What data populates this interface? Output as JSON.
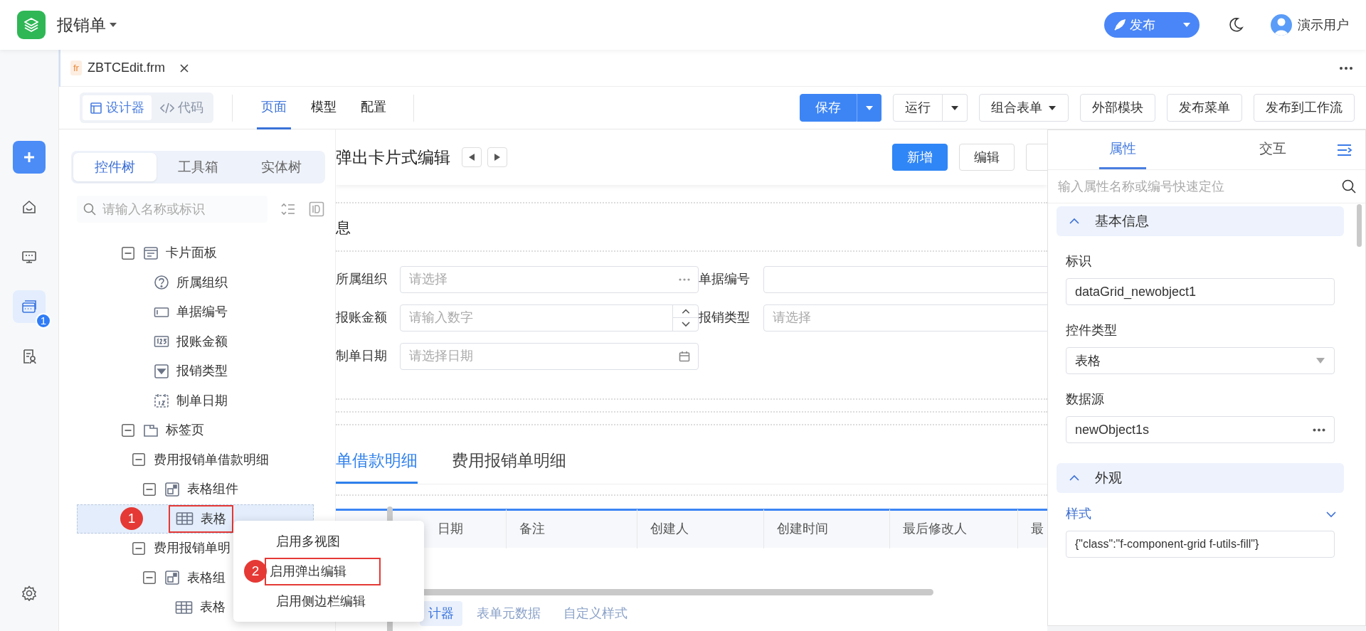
{
  "app": {
    "title": "报销单",
    "publish_button": "发布",
    "user": "演示用户"
  },
  "rail": [
    {
      "kind": "home",
      "selected": false
    },
    {
      "kind": "monitor",
      "selected": false
    },
    {
      "kind": "cards",
      "selected": true,
      "badge": "1"
    },
    {
      "kind": "doc",
      "selected": false
    },
    {
      "kind": "settings",
      "selected": false
    }
  ],
  "file_tab": {
    "prefix": "fr",
    "label": "ZBTCEdit.frm"
  },
  "mode_switch": [
    {
      "label": "设计器",
      "kind": "designer",
      "selected": true
    },
    {
      "label": "代码",
      "kind": "code",
      "selected": false
    }
  ],
  "view_tabs": [
    {
      "label": "页面",
      "selected": true
    },
    {
      "label": "模型",
      "selected": false
    },
    {
      "label": "配置",
      "selected": false
    }
  ],
  "toolbar_buttons": [
    {
      "label": "保存",
      "kind": "primary-split"
    },
    {
      "label": "运行",
      "kind": "split"
    },
    {
      "label": "组合表单",
      "kind": "dropdown"
    },
    {
      "label": "外部模块",
      "kind": "plain"
    },
    {
      "label": "发布菜单",
      "kind": "plain"
    },
    {
      "label": "发布到工作流",
      "kind": "plain"
    }
  ],
  "left_panel": {
    "tabs": [
      {
        "label": "控件树",
        "selected": true
      },
      {
        "label": "工具箱",
        "selected": false
      },
      {
        "label": "实体树",
        "selected": false
      }
    ],
    "search": {
      "placeholder": "请输入名称或标识"
    },
    "tree": [
      {
        "label": "卡片面板",
        "kind": "card",
        "expanded": true,
        "selected": false,
        "children": [
          {
            "label": "所属组织",
            "kind": "help",
            "selected": false
          },
          {
            "label": "单据编号",
            "kind": "input",
            "selected": false
          },
          {
            "label": "报账金额",
            "kind": "number",
            "selected": false
          },
          {
            "label": "报销类型",
            "kind": "select",
            "selected": false
          },
          {
            "label": "制单日期",
            "kind": "date",
            "selected": false
          }
        ]
      },
      {
        "label": "标签页",
        "kind": "tabs",
        "expanded": true,
        "selected": false,
        "children": [
          {
            "label": "费用报销单借款明细",
            "expanded": true,
            "selected": false,
            "children": [
              {
                "label": "表格组件",
                "kind": "component",
                "expanded": true,
                "selected": false,
                "children": [
                  {
                    "label": "表格",
                    "kind": "table",
                    "selected": true,
                    "marker": "1",
                    "boxed": true
                  }
                ]
              }
            ]
          },
          {
            "label": "费用报销单明",
            "expanded": true,
            "selected": false,
            "children": [
              {
                "label": "表格组",
                "kind": "component",
                "expanded": true,
                "selected": false,
                "children": [
                  {
                    "label": "表格",
                    "kind": "table",
                    "selected": false
                  }
                ]
              }
            ]
          }
        ]
      }
    ]
  },
  "context_menu": [
    {
      "label": "启用多视图"
    },
    {
      "label": "启用弹出编辑",
      "marker": "2",
      "boxed": true
    },
    {
      "label": "启用侧边栏编辑"
    }
  ],
  "preview": {
    "title": "弹出卡片式编辑",
    "header_buttons": [
      {
        "label": "新增",
        "kind": "primary"
      },
      {
        "label": "编辑",
        "kind": "plain"
      }
    ],
    "section_title": "息",
    "fields": [
      {
        "label": "所属组织",
        "placeholder": "请选择",
        "kind": "lookup"
      },
      {
        "label": "单据编号",
        "kind": "text"
      },
      {
        "label": "报账金额",
        "placeholder": "请输入数字",
        "kind": "number"
      },
      {
        "label": "报销类型",
        "placeholder": "请选择",
        "kind": "text"
      },
      {
        "label": "制单日期",
        "placeholder": "请选择日期",
        "kind": "date"
      }
    ],
    "tabs": [
      {
        "label": "单借款明细",
        "selected": true
      },
      {
        "label": "费用报销单明细",
        "selected": false
      }
    ],
    "table": {
      "columns": [
        "日期",
        "备注",
        "创建人",
        "创建时间",
        "最后修改人",
        "最"
      ]
    }
  },
  "bottom_tabs": [
    {
      "label": "计器",
      "selected": true
    },
    {
      "label": "表单元数据",
      "selected": false
    },
    {
      "label": "自定义样式",
      "selected": false
    }
  ],
  "properties": {
    "tabs": [
      {
        "label": "属性",
        "selected": true
      },
      {
        "label": "交互",
        "selected": false
      }
    ],
    "search": {
      "placeholder": "输入属性名称或编号快速定位"
    },
    "sections": [
      {
        "title": "基本信息",
        "expanded": true,
        "fields": [
          {
            "label": "标识",
            "value": "dataGrid_newobject1",
            "kind": "text"
          },
          {
            "label": "控件类型",
            "value": "表格",
            "kind": "select"
          },
          {
            "label": "数据源",
            "value": "newObject1s",
            "kind": "lookup"
          }
        ]
      },
      {
        "title": "外观",
        "expanded": true,
        "fields": [
          {
            "label": "样式",
            "value": "{\"class\":\"f-component-grid f-utils-fill\"}",
            "kind": "expandable"
          }
        ]
      }
    ]
  }
}
